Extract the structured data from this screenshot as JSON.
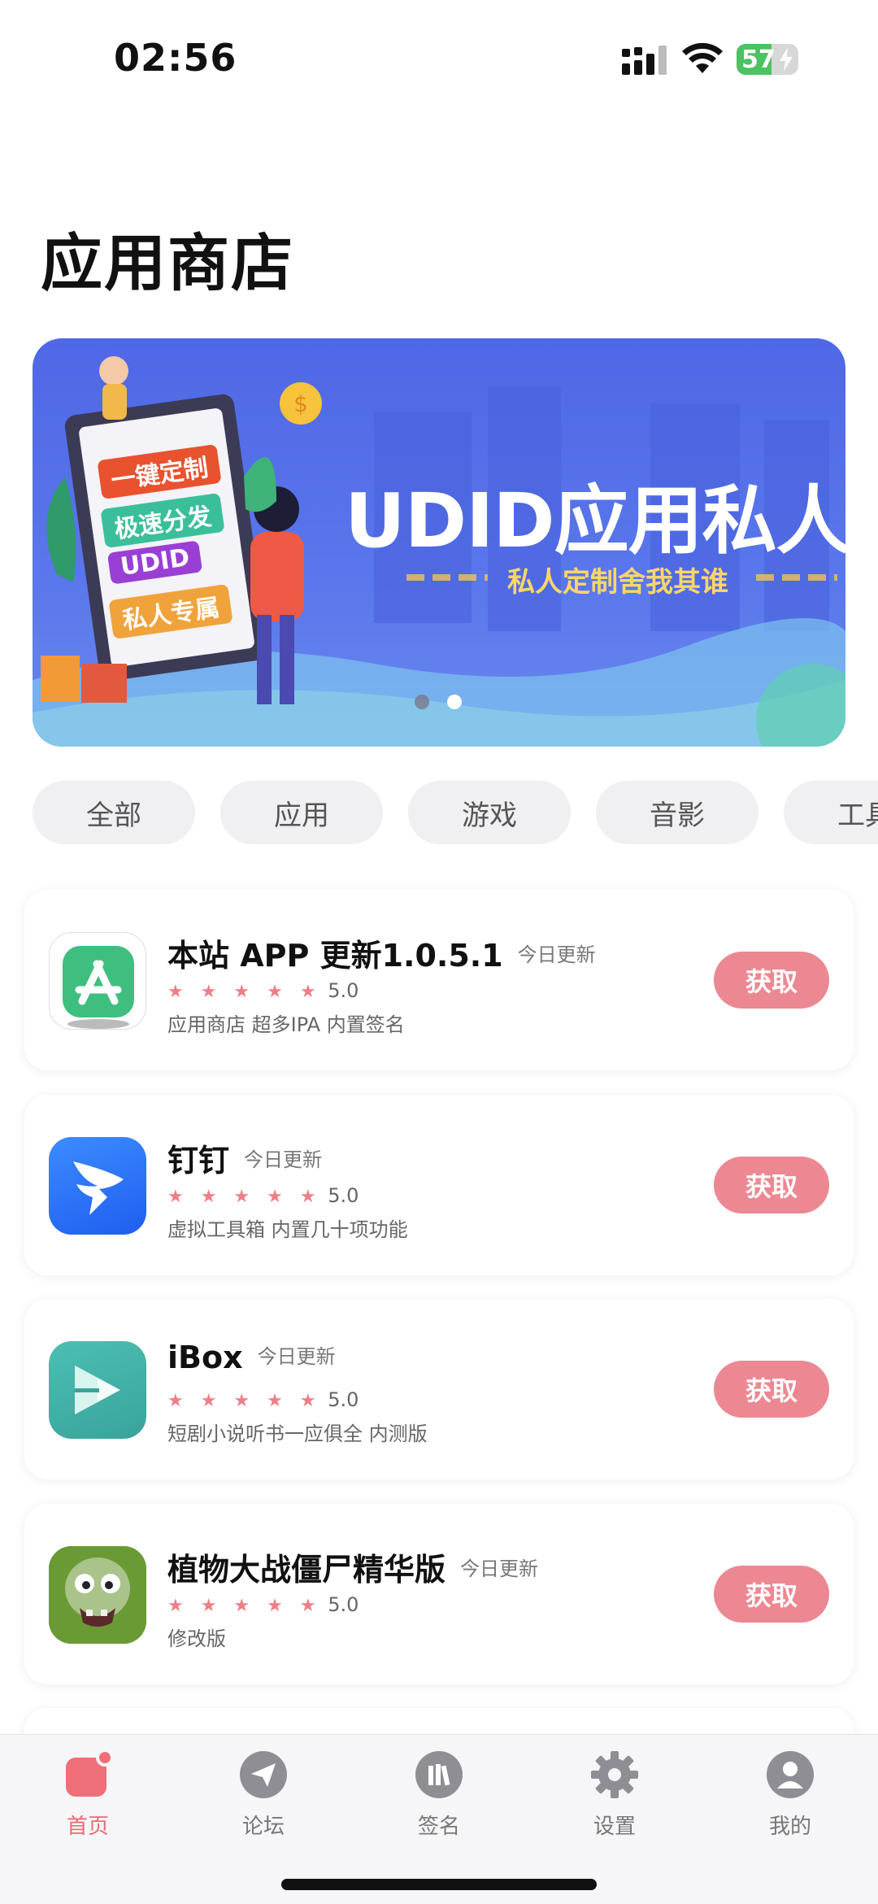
{
  "status_bar": {
    "time": "02:56",
    "battery_level": "57",
    "battery_fraction": 0.57
  },
  "page_title": "应用商店",
  "banner": {
    "headline": "UDID应用私人定制",
    "subline": "私人定制舍我其谁",
    "board_tags": [
      "一键定制",
      "极速分发",
      "UDID",
      "私人专属"
    ],
    "page_count": 2,
    "active_page": 2
  },
  "categories": [
    "全部",
    "应用",
    "游戏",
    "音影",
    "工具"
  ],
  "apps": [
    {
      "name": "本站 APP 更新1.0.5.1",
      "badge": "今日更新",
      "stars": "★ ★ ★ ★ ★",
      "rating": "5.0",
      "desc": "应用商店  超多IPA  内置签名",
      "button": "获取",
      "icon": "app-store-icon"
    },
    {
      "name": "钉钉",
      "badge": "今日更新",
      "stars": "★ ★ ★ ★ ★",
      "rating": "5.0",
      "desc": "虚拟工具箱  内置几十项功能",
      "button": "获取",
      "icon": "dingtalk-icon"
    },
    {
      "name": "iBox",
      "badge": "今日更新",
      "stars": "★ ★ ★ ★ ★",
      "rating": "5.0",
      "desc": "短剧小说听书一应俱全  内测版",
      "button": "获取",
      "icon": "ibox-icon"
    },
    {
      "name": "植物大战僵尸精华版",
      "badge": "今日更新",
      "stars": "★ ★ ★ ★ ★",
      "rating": "5.0",
      "desc": "修改版",
      "button": "获取",
      "icon": "zombie-icon"
    }
  ],
  "tabbar": [
    {
      "label": "首页",
      "icon": "home-icon",
      "active": true
    },
    {
      "label": "论坛",
      "icon": "paper-plane-icon",
      "active": false
    },
    {
      "label": "签名",
      "icon": "books-icon",
      "active": false
    },
    {
      "label": "设置",
      "icon": "gear-icon",
      "active": false
    },
    {
      "label": "我的",
      "icon": "person-icon",
      "active": false
    }
  ],
  "colors": {
    "accent": "#ec8892",
    "tab_active": "#ec6a74",
    "banner_bg": "#5a77ec",
    "banner_sub": "#ffd66a"
  }
}
